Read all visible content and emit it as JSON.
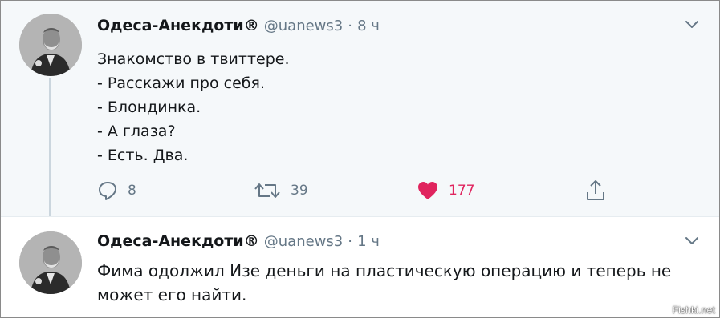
{
  "tweets": [
    {
      "name": "Одеса-Анекдоти®",
      "handle": "@uanews3",
      "separator": "·",
      "time": "8 ч",
      "lines": [
        "Знакомство в твиттере.",
        "- Расскажи про себя.",
        "- Блондинка.",
        "- А глаза?",
        "- Есть. Два."
      ],
      "replies": "8",
      "retweets": "39",
      "likes": "177"
    },
    {
      "name": "Одеса-Анекдоти®",
      "handle": "@uanews3",
      "separator": "·",
      "time": "1 ч",
      "text": "Фима одолжил Изе деньги на пластическую операцию и теперь не может его найти."
    }
  ],
  "watermark": "Fishki.net",
  "colors": {
    "like": "#e0245e",
    "muted": "#657786",
    "thread_line": "#cbd6de",
    "tweet1_bg": "#f5f8fa"
  },
  "icons": [
    "reply-icon",
    "retweet-icon",
    "heart-icon",
    "share-icon",
    "chevron-down-icon"
  ]
}
